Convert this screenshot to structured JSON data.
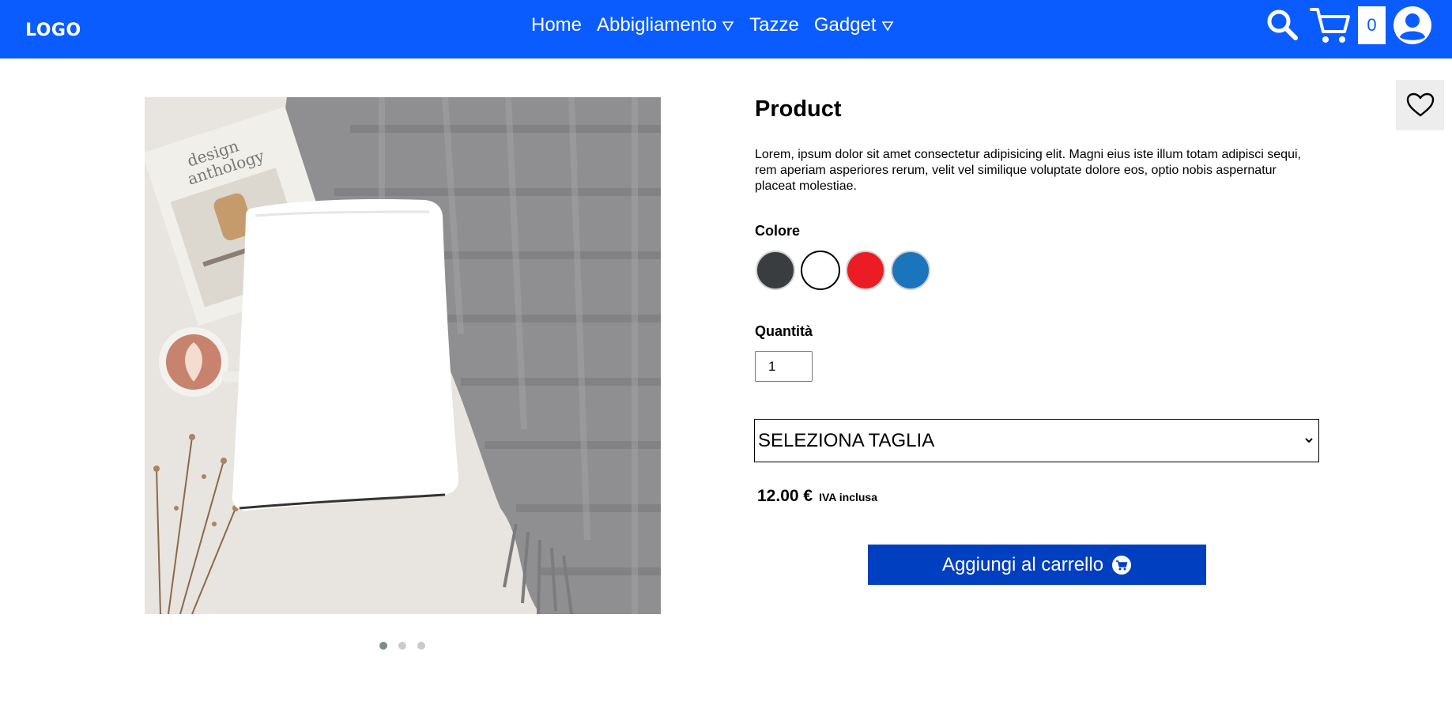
{
  "header": {
    "logo": "LOGO",
    "nav": {
      "home": "Home",
      "abbigliamento": "Abbigliamento",
      "tazze": "Tazze",
      "gadget": "Gadget"
    },
    "cart_count": "0",
    "color": "#0a5cff"
  },
  "product": {
    "title": "Product",
    "description": "Lorem, ipsum dolor sit amet consectetur adipisicing elit. Magni eius iste illum totam adipisci sequi, rem aperiam asperiores rerum, velit vel similique voluptate dolore eos, optio nobis aspernatur placeat molestiae.",
    "colore_label": "Colore",
    "swatches": [
      {
        "name": "dark-gray",
        "color": "#3a3d40"
      },
      {
        "name": "white",
        "color": "#ffffff"
      },
      {
        "name": "red",
        "color": "#ec1c24"
      },
      {
        "name": "blue",
        "color": "#1b75bc"
      }
    ],
    "quantita_label": "Quantità",
    "quantity": "1",
    "size_select": "SELEZIONA TAGLIA",
    "price": "12.00 €",
    "vat": "IVA inclusa",
    "add_to_cart": "Aggiungi al carrello",
    "carousel_dots": 3,
    "carousel_active": 1
  }
}
